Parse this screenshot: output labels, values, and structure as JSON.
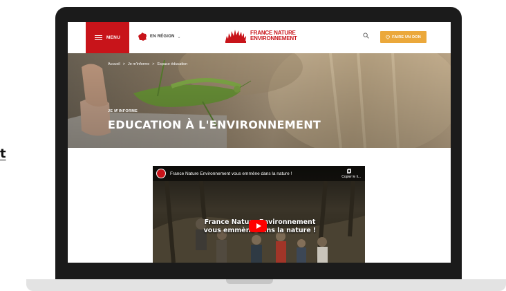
{
  "page": {
    "edge_text": "t"
  },
  "header": {
    "menu_label": "MENU",
    "region_label": "EN RÉGION",
    "logo_line1": "FRANCE NATURE",
    "logo_line2": "ENVIRONNEMENT",
    "donate_label": "FAIRE UN DON",
    "accent_color": "#c8141a",
    "donate_color": "#eba83b"
  },
  "breadcrumb": [
    "Accueil",
    ">",
    "Je m'informe",
    ">",
    "Espace éducation"
  ],
  "hero": {
    "eyebrow": "JE M'INFORME",
    "title": "EDUCATION À L'ENVIRONNEMENT"
  },
  "video": {
    "title": "France Nature Environnement vous emmène dans la nature !",
    "copy_label": "Copier le li...",
    "overlay_line1": "France Nature Environnement",
    "overlay_line2": "vous emmène dans la nature !",
    "play_color": "#ff0000"
  }
}
